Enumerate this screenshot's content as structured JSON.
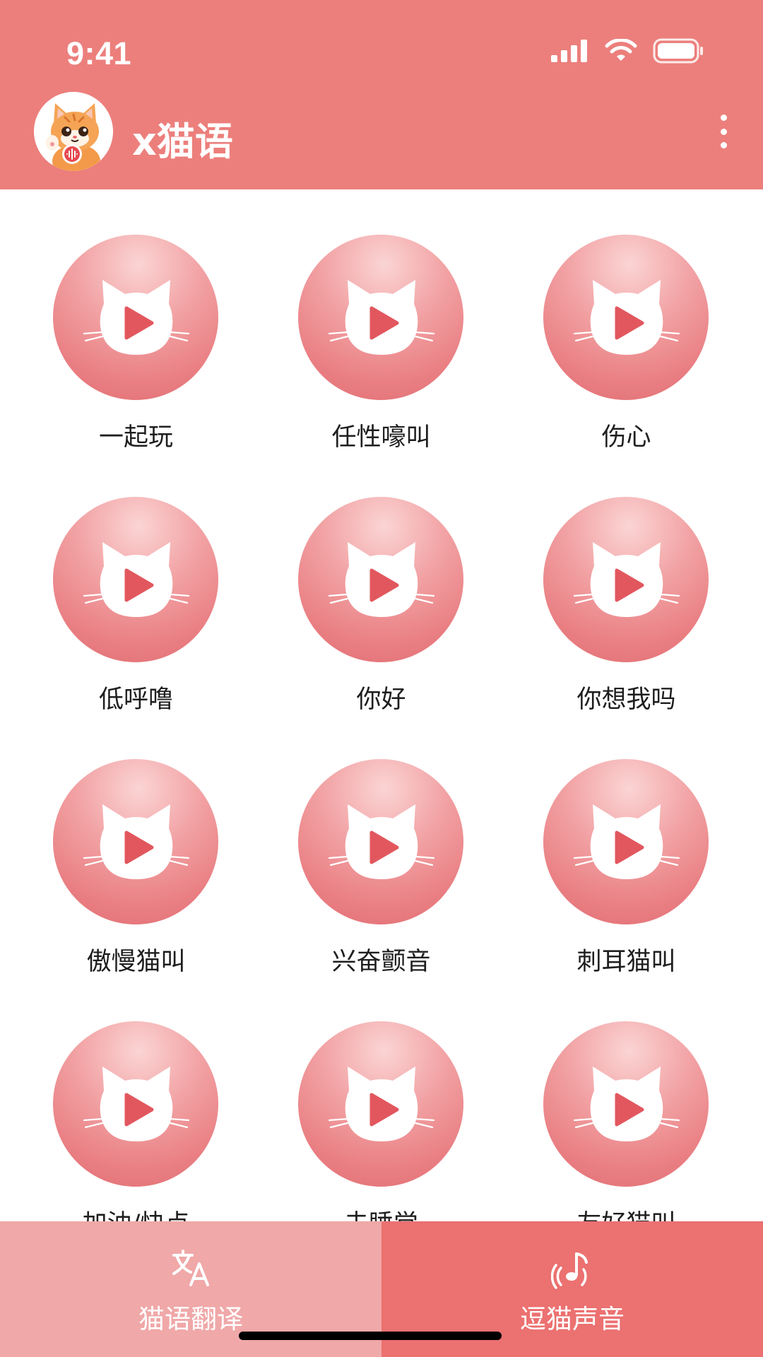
{
  "status_bar": {
    "time": "9:41"
  },
  "header": {
    "title": "x猫语",
    "avatar_icon": "cat-avatar-icon",
    "more_icon": "more-vertical-icon",
    "background": "#ec7f7c"
  },
  "sounds": [
    {
      "label": "一起玩"
    },
    {
      "label": "任性嚎叫"
    },
    {
      "label": "伤心"
    },
    {
      "label": "低呼噜"
    },
    {
      "label": "你好"
    },
    {
      "label": "你想我吗"
    },
    {
      "label": "傲慢猫叫"
    },
    {
      "label": "兴奋颤音"
    },
    {
      "label": "刺耳猫叫"
    },
    {
      "label": "加油/快点"
    },
    {
      "label": "去睡觉"
    },
    {
      "label": "友好猫叫"
    }
  ],
  "tabs": [
    {
      "label": "猫语翻译",
      "icon": "translate-icon",
      "color": "#f0a8a8"
    },
    {
      "label": "逗猫声音",
      "icon": "music-note-icon",
      "color": "#ec7171"
    }
  ]
}
